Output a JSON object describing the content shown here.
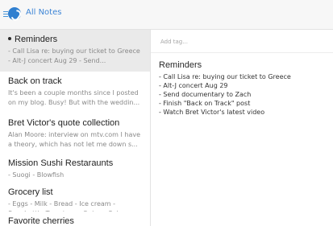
{
  "header": {
    "title": "All Notes",
    "menu_icon": "menu-icon",
    "logo_icon": "simplenote-logo-icon",
    "accent_color": "#3d85d6"
  },
  "notes": [
    {
      "title": "Reminders",
      "pinned": true,
      "preview": [
        "- Call Lisa re: buying our ticket to Greece",
        "- Alt-J concert Aug 29 - Send..."
      ]
    },
    {
      "title": "Back on track",
      "preview": [
        "It's been a couple months since I posted",
        "on my blog. Busy! But with the weddin..."
      ]
    },
    {
      "title": "Bret Victor's quote collection",
      "preview": [
        "Alan Moore: interview on mtv.com I have",
        "a theory, which has not let me down s..."
      ]
    },
    {
      "title": "Mission Sushi Restaraunts",
      "preview": [
        "- Suogi - Blowfish"
      ]
    },
    {
      "title": "Grocery list",
      "preview": [
        "- Eggs - Milk - Bread - Ice cream -",
        "Spaghetti - Tomatoes - Onion - Spinac..."
      ]
    },
    {
      "title": "Favorite cherries",
      "preview": []
    }
  ],
  "editor": {
    "tag_placeholder": "Add tag...",
    "title": "Reminders",
    "lines": [
      "- Call Lisa re: buying our ticket to Greece",
      "- Alt-J concert Aug 29",
      "- Send documentary to Zach",
      "- Finish \"Back on Track\" post",
      "- Watch Bret Victor's latest video"
    ]
  }
}
